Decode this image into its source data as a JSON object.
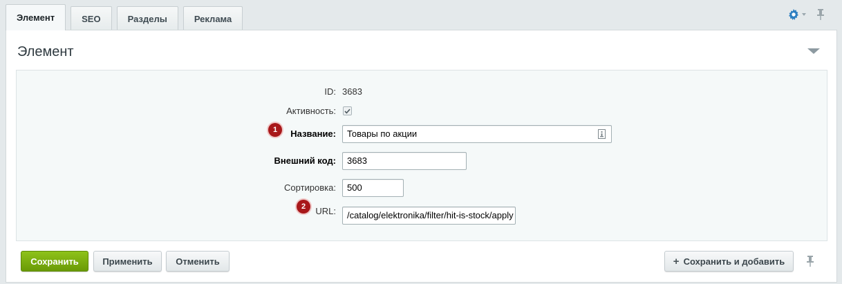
{
  "tabs": [
    {
      "label": "Элемент",
      "active": true
    },
    {
      "label": "SEO",
      "active": false
    },
    {
      "label": "Разделы",
      "active": false
    },
    {
      "label": "Реклама",
      "active": false
    }
  ],
  "panel": {
    "title": "Элемент"
  },
  "fields": {
    "id": {
      "label": "ID:",
      "value": "3683"
    },
    "active": {
      "label": "Активность:",
      "checked": true
    },
    "name": {
      "label": "Название:",
      "value": "Товары по акции",
      "badge": "1"
    },
    "external_code": {
      "label": "Внешний код:",
      "value": "3683"
    },
    "sort": {
      "label": "Сортировка:",
      "value": "500"
    },
    "url": {
      "label": "URL:",
      "value": "/catalog/elektronika/filter/hit-is-stock/apply",
      "badge": "2"
    }
  },
  "buttons": {
    "save": "Сохранить",
    "apply": "Применить",
    "cancel": "Отменить",
    "save_and_add": "Сохранить и добавить"
  },
  "icons": {
    "settings": "gear-icon",
    "pin": "pin-icon",
    "collapse": "collapse-arrow-icon",
    "translit": "translit-icon",
    "add": "plus-icon"
  },
  "colors": {
    "accent_green": "#7bb012",
    "badge_red": "#a8181a",
    "gear_blue": "#2d7fc1"
  }
}
